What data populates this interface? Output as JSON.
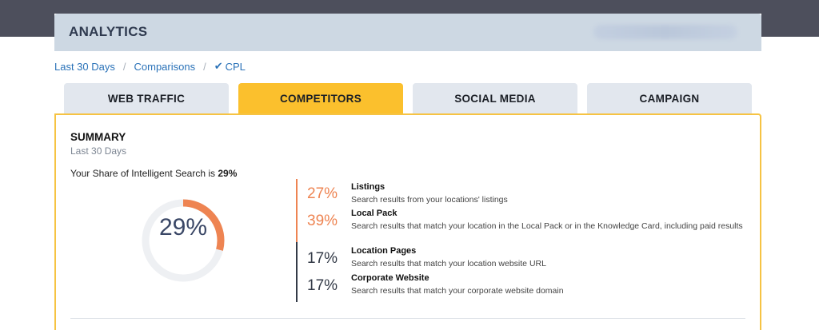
{
  "header": {
    "title": "ANALYTICS"
  },
  "breadcrumb": {
    "items": [
      {
        "label": "Last 30 Days"
      },
      {
        "label": "Comparisons"
      },
      {
        "label": "CPL"
      }
    ],
    "separator": "/",
    "check_icon": "check-icon"
  },
  "tabs": [
    {
      "label": "WEB TRAFFIC",
      "active": false
    },
    {
      "label": "COMPETITORS",
      "active": true
    },
    {
      "label": "SOCIAL MEDIA",
      "active": false
    },
    {
      "label": "CAMPAIGN",
      "active": false
    }
  ],
  "summary": {
    "title": "SUMMARY",
    "subtitle": "Last 30 Days",
    "share_text": "Your Share of Intelligent Search is ",
    "share_value": "29%",
    "donut": {
      "label": "29%",
      "fraction": 0.29,
      "color": "#ee8452",
      "track_color": "#eef0f3"
    }
  },
  "breakdown": [
    {
      "pct": "27%",
      "title": "Listings",
      "desc": "Search results from your locations' listings",
      "color": "#ee8452"
    },
    {
      "pct": "39%",
      "title": "Local Pack",
      "desc": "Search results that match your location in the Local Pack or in the Knowledge Card, including paid results",
      "color": "#ee8452"
    },
    {
      "pct": "17%",
      "title": "Location Pages",
      "desc": "Search results that match your location website URL",
      "color": "#333a47"
    },
    {
      "pct": "17%",
      "title": "Corporate Website",
      "desc": "Search results that match your corporate website domain",
      "color": "#333a47"
    }
  ],
  "colors": {
    "accent": "#fbc02d",
    "link": "#2a72b8",
    "header_bg": "#cdd8e3",
    "top_bar": "#4d4f5c",
    "orange": "#ee8452"
  }
}
